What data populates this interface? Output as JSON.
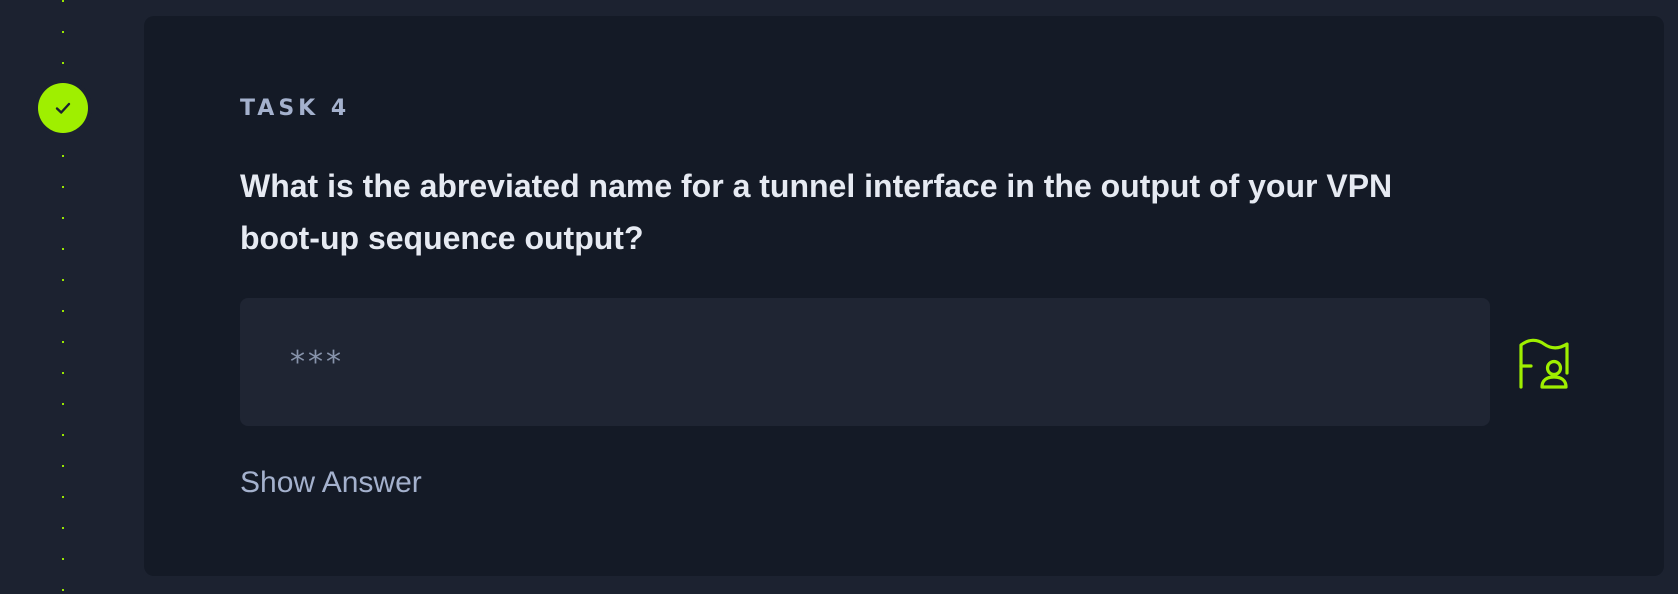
{
  "timeline": {
    "status": "completed",
    "status_icon": "check-icon",
    "accent_color": "#9fef00"
  },
  "task": {
    "label": "TASK 4",
    "question": "What is the abreviated name for a tunnel interface in the output of your VPN boot-up sequence output?",
    "answer_masked": "***",
    "submit_icon": "flag-user-icon",
    "show_answer_label": "Show Answer"
  },
  "colors": {
    "page_bg": "#1c2230",
    "card_bg": "#141a26",
    "input_bg": "#1f2533",
    "accent": "#9fef00",
    "text_primary": "#e6eaf2",
    "text_secondary": "#a4b1cd"
  }
}
